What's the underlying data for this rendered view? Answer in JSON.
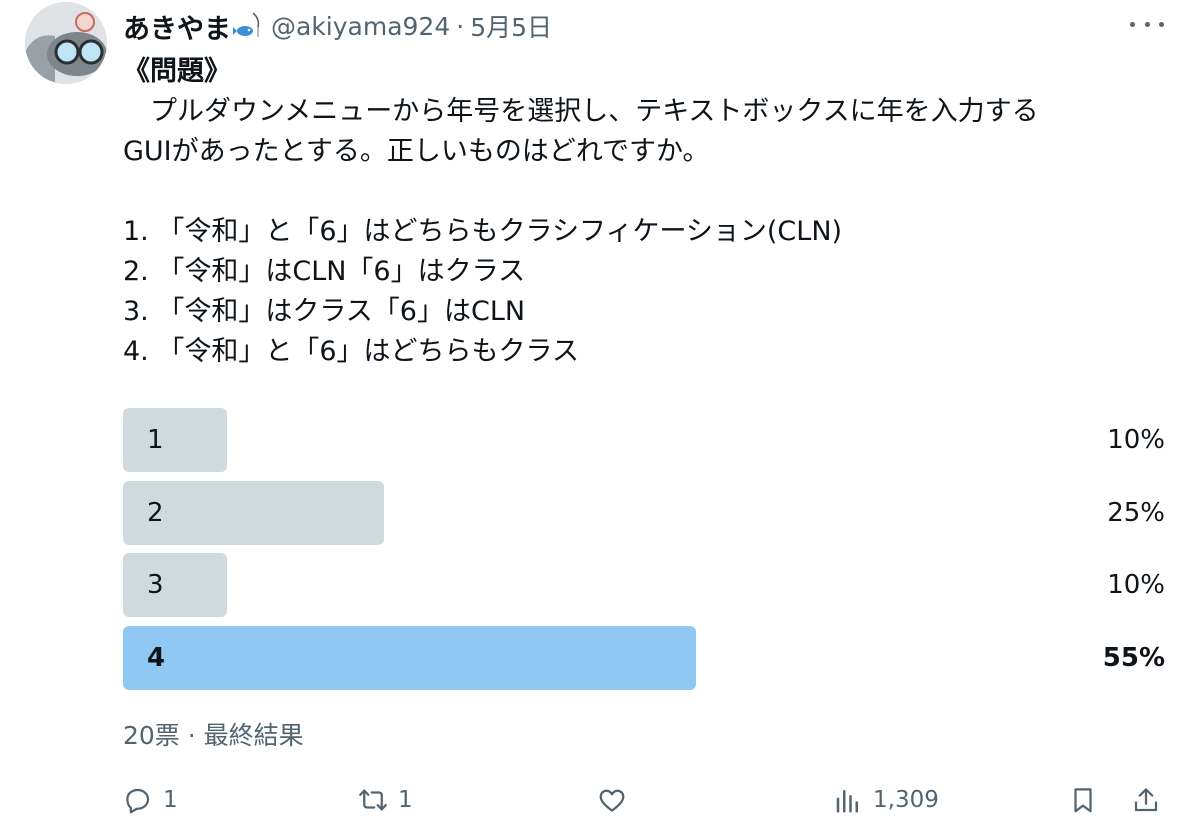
{
  "tweet": {
    "author_name": "あきやま",
    "author_emoji": "fishing-icon",
    "handle": "@akiyama924",
    "separator": "·",
    "date": "5月5日",
    "text_lines": [
      "《問題》",
      "　プルダウンメニューから年号を選択し、テキストボックスに年を入力する",
      "GUIがあったとする。正しいものはどれですか。",
      "",
      "1. 「令和」と「6」はどちらもクラシフィケーション(CLN)",
      "2. 「令和」はCLN「6」はクラス",
      "3. 「令和」はクラス「6」はCLN",
      "4. 「令和」と「6」はどちらもクラス"
    ]
  },
  "poll": {
    "options": [
      {
        "label": "1",
        "percent_text": "10%",
        "percent": 10
      },
      {
        "label": "2",
        "percent_text": "25%",
        "percent": 25
      },
      {
        "label": "3",
        "percent_text": "10%",
        "percent": 10
      },
      {
        "label": "4",
        "percent_text": "55%",
        "percent": 55
      }
    ],
    "winner_index": 3,
    "meta": "20票 · 最終結果",
    "colors": {
      "bar": "#cfd9de",
      "winner_bar": "#8ec8f3"
    }
  },
  "actions": {
    "reply_count": "1",
    "retweet_count": "1",
    "like_count": "",
    "views_count": "1,309",
    "icons": [
      "reply-icon",
      "retweet-icon",
      "like-icon",
      "views-icon",
      "bookmark-icon",
      "share-icon"
    ]
  }
}
